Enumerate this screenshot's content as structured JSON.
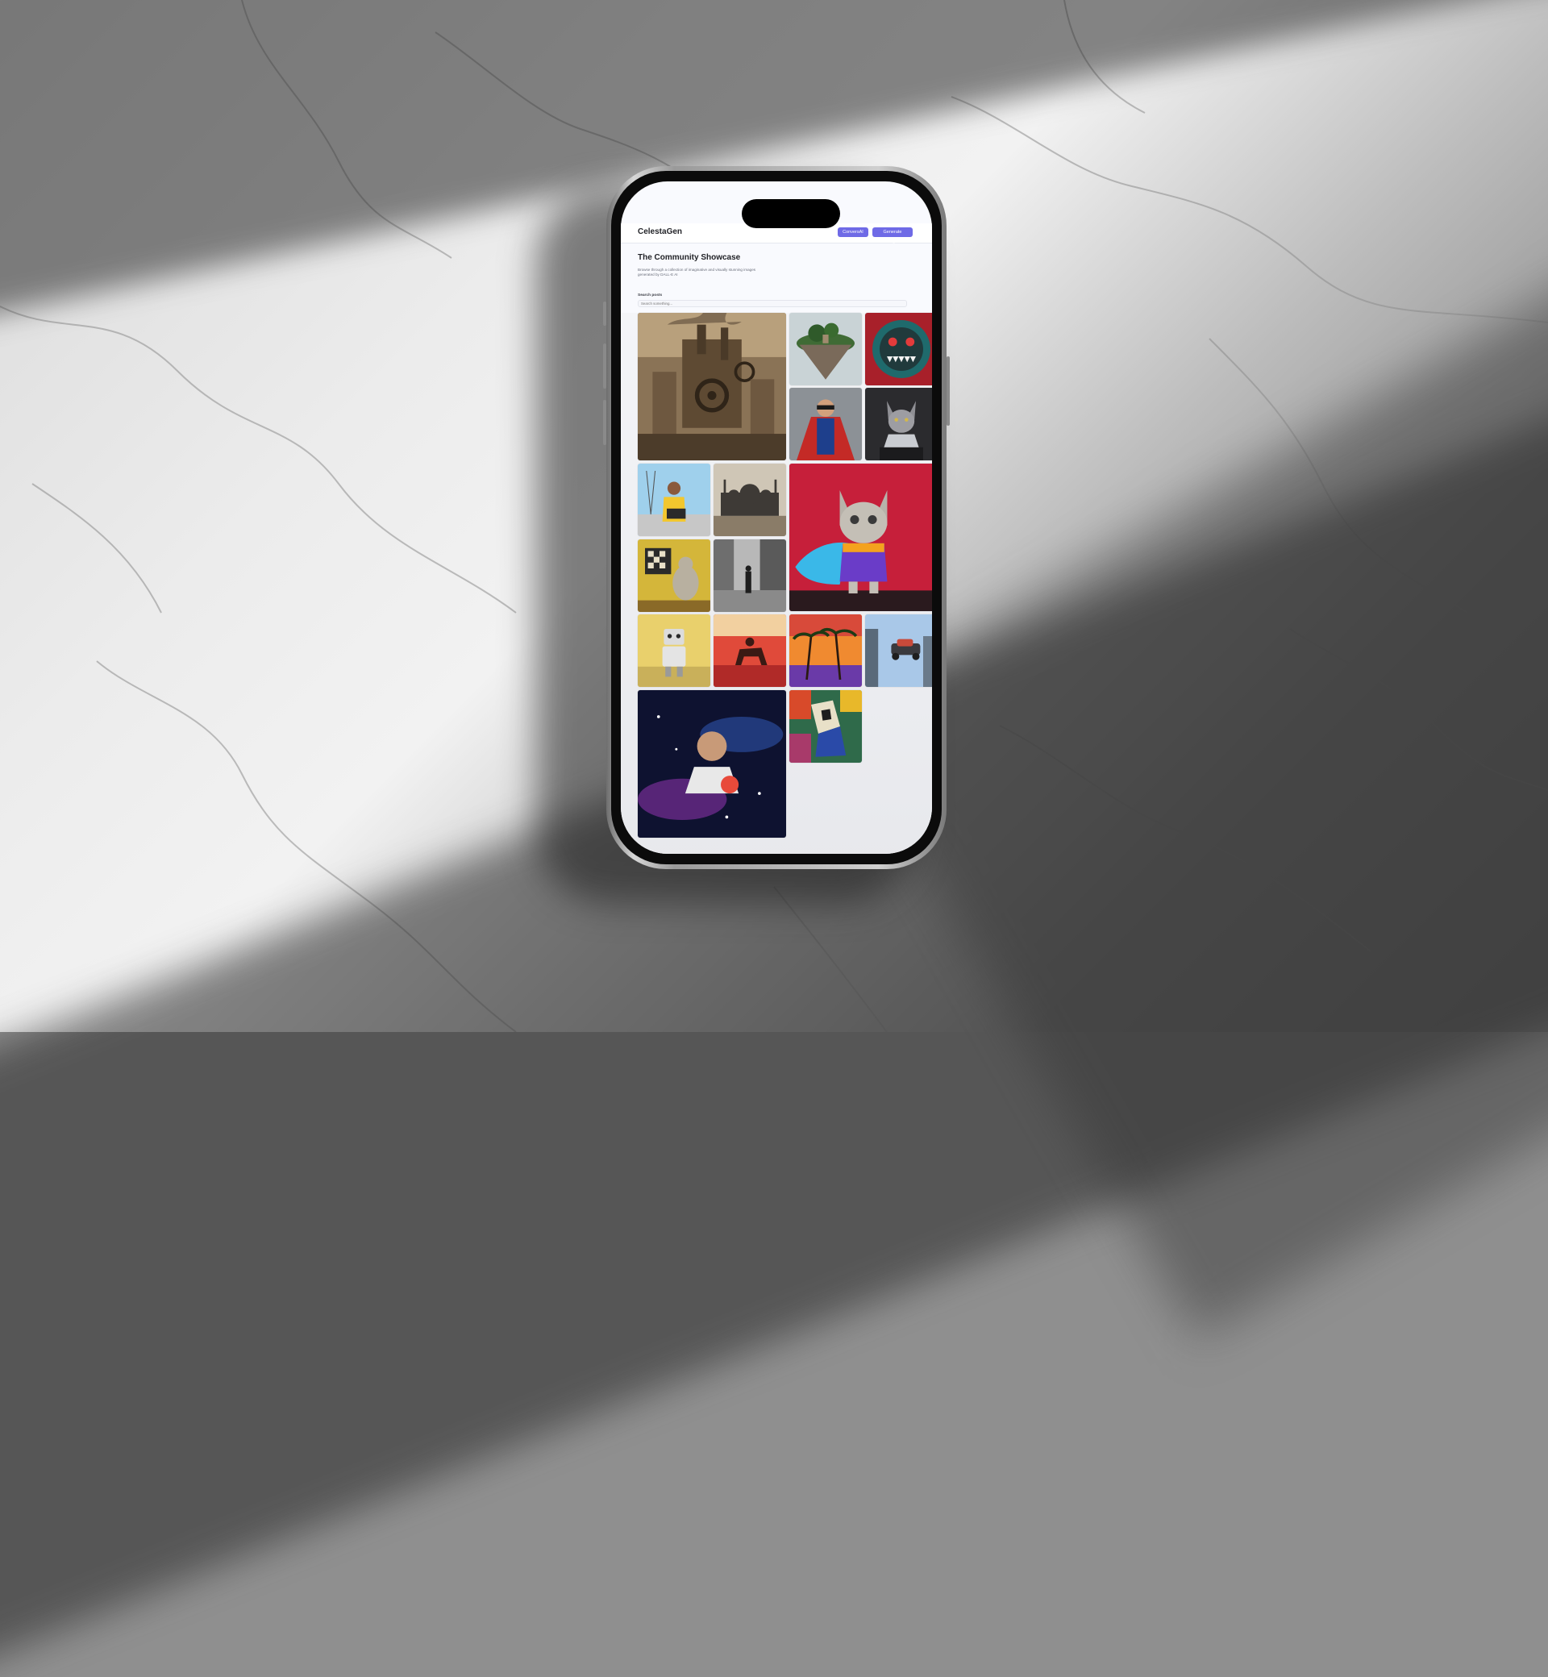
{
  "app": {
    "logo": "CelestaGen",
    "nav_buttons": [
      "ConversAI",
      "Generate Images"
    ]
  },
  "showcase": {
    "title": "The Community Showcase",
    "description": "Browse through a collection of imaginative and visually stunning images generated by DALL-E AI",
    "search_label": "Search posts",
    "search_placeholder": "Search something..."
  },
  "posts": [
    {
      "subject": "steampunk city with gears and smokestacks",
      "icon": "steampunk-city"
    },
    {
      "subject": "floating island with trees",
      "icon": "floating-island"
    },
    {
      "subject": "monster face bowl",
      "icon": "monster-bowl"
    },
    {
      "subject": "superhero in red cape",
      "icon": "superhero"
    },
    {
      "subject": "cat in armor",
      "icon": "armored-cat"
    },
    {
      "subject": "cartoon man with laptop",
      "icon": "man-laptop"
    },
    {
      "subject": "mosque skyline",
      "icon": "mosque"
    },
    {
      "subject": "cat in superhero cape",
      "icon": "cape-cat"
    },
    {
      "subject": "cat playing chess",
      "icon": "chess-cat"
    },
    {
      "subject": "black and white street scene",
      "icon": "street-photo"
    },
    {
      "subject": "robot toy",
      "icon": "robot"
    },
    {
      "subject": "red horse rider painting",
      "icon": "horse-rider"
    },
    {
      "subject": "palm trees sunset",
      "icon": "palm-sunset"
    },
    {
      "subject": "flying car in city",
      "icon": "flying-car"
    },
    {
      "subject": "man in space with galaxy",
      "icon": "space-man"
    },
    {
      "subject": "cubist abstract painting",
      "icon": "cubist-art"
    }
  ],
  "colors": {
    "accent": "#6f6ae6",
    "background": "#f9fafe"
  }
}
